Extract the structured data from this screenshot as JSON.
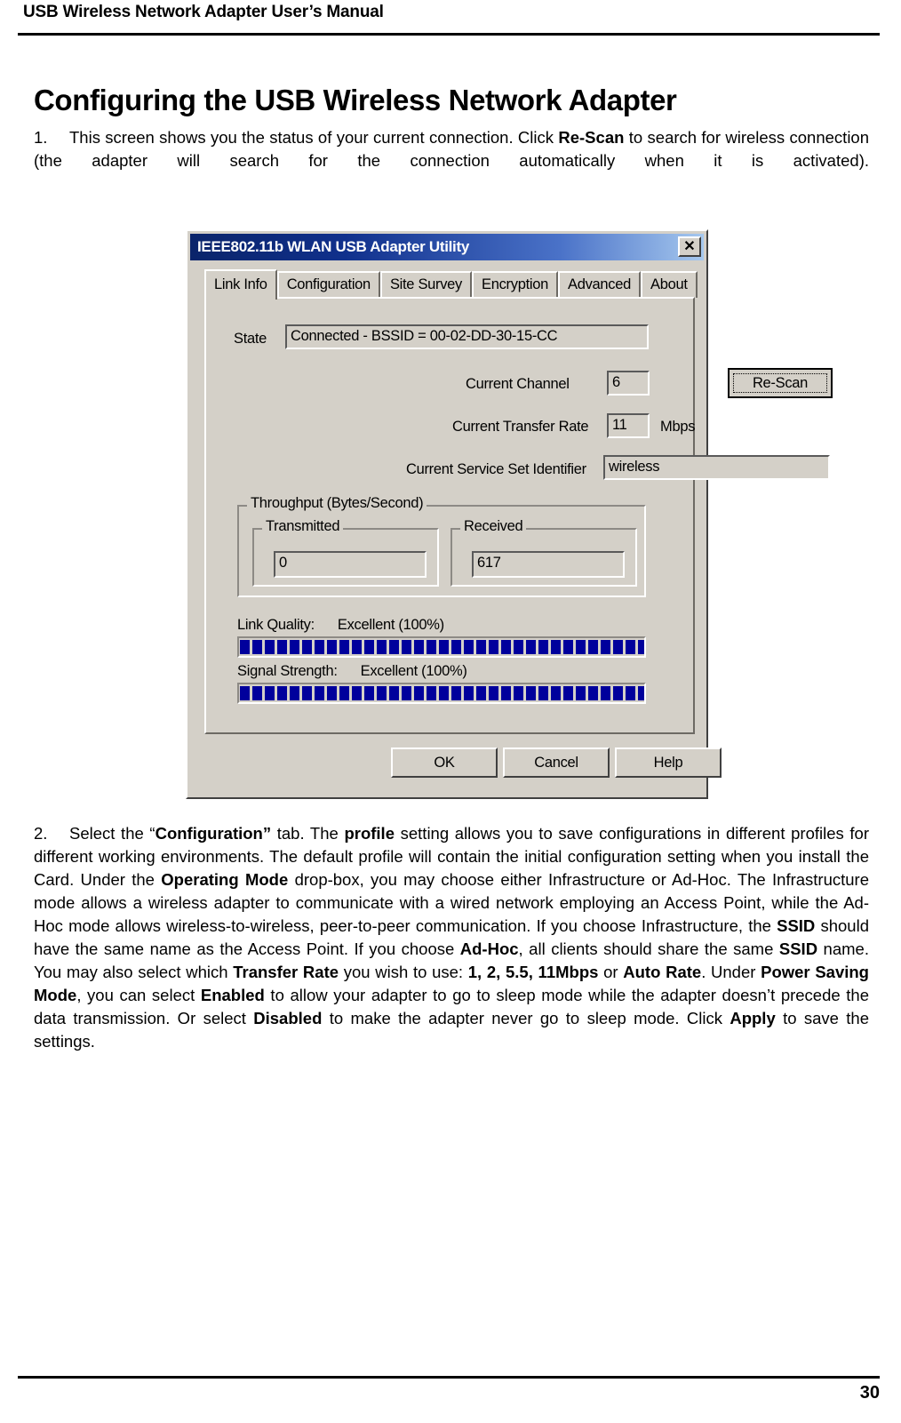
{
  "header": {
    "title": "USB Wireless Network Adapter User’s Manual"
  },
  "heading": "Configuring the USB Wireless Network Adapter",
  "paragraphs": [
    {
      "number": "1.",
      "runs": [
        {
          "text": "This screen shows you the status of your current connection. Click ",
          "bold": false
        },
        {
          "text": "Re-Scan",
          "bold": true
        },
        {
          "text": " to search for wireless connection (the adapter will search for the connection automatically when it is activated).",
          "bold": false
        }
      ]
    },
    {
      "number": "2.",
      "runs": [
        {
          "text": "Select the “",
          "bold": false
        },
        {
          "text": "Configuration”",
          "bold": true
        },
        {
          "text": " tab. The ",
          "bold": false
        },
        {
          "text": "profile",
          "bold": true
        },
        {
          "text": " setting allows you to save configurations in different profiles for different working environments. The default profile will contain the initial configuration setting when you install the Card. Under the ",
          "bold": false
        },
        {
          "text": "Operating Mode",
          "bold": true
        },
        {
          "text": " drop-box, you may choose either Infrastructure or Ad-Hoc. The Infrastructure mode allows a wireless adapter to communicate with a wired network employing an Access Point, while the Ad-Hoc mode allows wireless-to-wireless, peer-to-peer communication. If you choose Infrastructure, the ",
          "bold": false
        },
        {
          "text": "SSID",
          "bold": true
        },
        {
          "text": " should have the same name as the Access Point. If you choose ",
          "bold": false
        },
        {
          "text": "Ad-Hoc",
          "bold": true
        },
        {
          "text": ", all clients should share the same ",
          "bold": false
        },
        {
          "text": "SSID",
          "bold": true
        },
        {
          "text": " name. You may also select which ",
          "bold": false
        },
        {
          "text": "Transfer Rate",
          "bold": true
        },
        {
          "text": " you wish to use: ",
          "bold": false
        },
        {
          "text": "1, 2, 5.5, 11Mbps",
          "bold": true
        },
        {
          "text": " or ",
          "bold": false
        },
        {
          "text": "Auto Rate",
          "bold": true
        },
        {
          "text": ". Under ",
          "bold": false
        },
        {
          "text": "Power Saving Mode",
          "bold": true
        },
        {
          "text": ", you can select ",
          "bold": false
        },
        {
          "text": "Enabled",
          "bold": true
        },
        {
          "text": " to allow your adapter to go to sleep mode while the adapter doesn’t precede the data transmission. Or select ",
          "bold": false
        },
        {
          "text": "Disabled",
          "bold": true
        },
        {
          "text": " to make the adapter never go to sleep mode. Click ",
          "bold": false
        },
        {
          "text": "Apply",
          "bold": true
        },
        {
          "text": " to save the settings.",
          "bold": false
        }
      ]
    }
  ],
  "dialog": {
    "title": "IEEE802.11b WLAN USB Adapter Utility",
    "close_icon": "close-icon",
    "close_glyph": "✕",
    "tabs": [
      {
        "label": "Link Info",
        "selected": true
      },
      {
        "label": "Configuration",
        "selected": false
      },
      {
        "label": "Site Survey",
        "selected": false
      },
      {
        "label": "Encryption",
        "selected": false
      },
      {
        "label": "Advanced",
        "selected": false
      },
      {
        "label": "About",
        "selected": false
      }
    ],
    "fields": {
      "state_label": "State",
      "state_value": "Connected - BSSID = 00-02-DD-30-15-CC",
      "channel_label": "Current Channel",
      "channel_value": "6",
      "rate_label": "Current Transfer Rate",
      "rate_value": "11",
      "rate_unit": "Mbps",
      "ssid_label": "Current Service Set Identifier",
      "ssid_value": "wireless"
    },
    "rescan_button": "Re-Scan",
    "throughput": {
      "legend": "Throughput (Bytes/Second)",
      "transmitted_legend": "Transmitted",
      "transmitted_value": "0",
      "received_legend": "Received",
      "received_value": "617"
    },
    "meters": {
      "link_quality_label": "Link Quality:",
      "link_quality_value": "Excellent (100%)",
      "link_quality_percent": 100,
      "signal_strength_label": "Signal Strength:",
      "signal_strength_value": "Excellent (100%)",
      "signal_strength_percent": 100,
      "block_count": 33,
      "block_color": "#00009c"
    },
    "buttons": {
      "ok": "OK",
      "cancel": "Cancel",
      "help": "Help"
    }
  },
  "footer": {
    "page_number": "30"
  }
}
